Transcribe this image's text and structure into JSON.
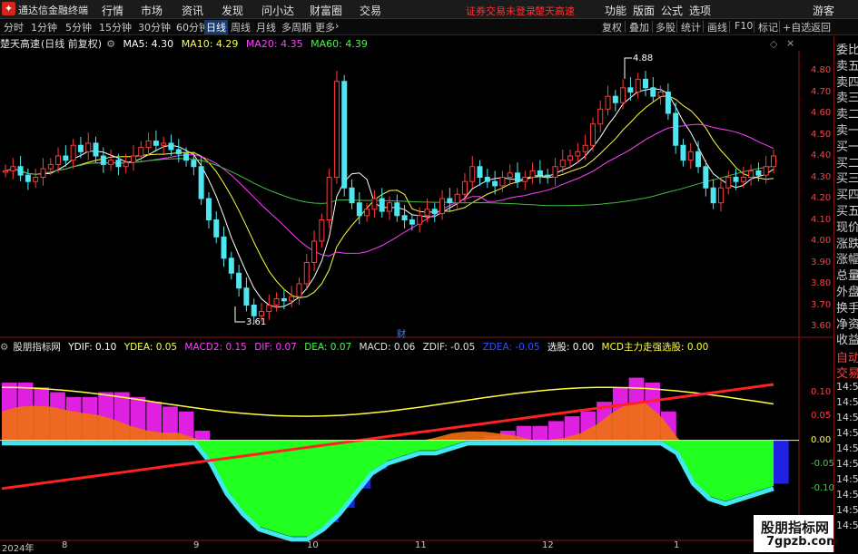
{
  "app": {
    "title": "通达信金融终端",
    "menu": [
      "行情",
      "市场",
      "资讯",
      "发现",
      "问小达",
      "财富圈",
      "交易"
    ],
    "notice": [
      "证券交易未登录",
      "楚天高速"
    ],
    "right_menu": [
      "功能",
      "版面",
      "公式",
      "选项"
    ],
    "guest": "游客"
  },
  "toolbar": {
    "periods": [
      "分时",
      "1分钟",
      "5分钟",
      "15分钟",
      "30分钟",
      "60分钟",
      "日线",
      "周线",
      "月线",
      "多周期",
      "更多"
    ],
    "active_period": "日线",
    "actions": [
      "复权",
      "叠加",
      "多股",
      "统计",
      "画线",
      "F10",
      "标记",
      "+自选",
      "返回"
    ]
  },
  "quote": {
    "name": "楚天高速",
    "mode": "(日线 前复权)",
    "ma": [
      {
        "label": "MA5: 4.30",
        "color": "#ffffff"
      },
      {
        "label": "MA10: 4.29",
        "color": "#ffff40"
      },
      {
        "label": "MA20: 4.35",
        "color": "#ff40ff"
      },
      {
        "label": "MA60: 4.39",
        "color": "#40ff40"
      }
    ],
    "high_label": "4.88",
    "low_label": "3.61",
    "event_marker": "财"
  },
  "price_axis": [
    "4.80",
    "4.70",
    "4.60",
    "4.50",
    "4.40",
    "4.30",
    "4.20",
    "4.10",
    "4.00",
    "3.90",
    "3.80",
    "3.70",
    "3.60"
  ],
  "indicator": {
    "name": "股朋指标网",
    "values": [
      {
        "label": "YDIF: 0.10",
        "color": "#ffffff"
      },
      {
        "label": "YDEA: 0.05",
        "color": "#ffff40"
      },
      {
        "label": "MACD2: 0.15",
        "color": "#ff40ff"
      },
      {
        "label": "DIF: 0.07",
        "color": "#ff40ff"
      },
      {
        "label": "DEA: 0.07",
        "color": "#40ff40"
      },
      {
        "label": "MACD: 0.06",
        "color": "#e0e0e0"
      },
      {
        "label": "ZDIF: -0.05",
        "color": "#e0e0e0"
      },
      {
        "label": "ZDEA: -0.05",
        "color": "#3050ff"
      },
      {
        "label": "选股: 0.00",
        "color": "#ffffff"
      },
      {
        "label": "MCD主力走强选股: 0.00",
        "color": "#ffff40"
      }
    ],
    "axis": [
      "0.10",
      "0.05",
      "0.00",
      "-0.05",
      "-0.10"
    ]
  },
  "x_axis": [
    "2024年",
    "8",
    "9",
    "10",
    "11",
    "12",
    "1"
  ],
  "right_panel": {
    "order_book": [
      "委比",
      "卖五",
      "卖四",
      "卖三",
      "卖二",
      "卖一",
      "买一",
      "买二",
      "买三",
      "买四",
      "买五",
      "现价",
      "涨跌",
      "涨幅",
      "总量",
      "外盘",
      "换手",
      "净资",
      "收益"
    ],
    "trade_tabs": [
      "自动",
      "交易"
    ],
    "ticks": [
      "14:56",
      "14:56",
      "14:56",
      "14:56",
      "14:56",
      "14:56",
      "14:56",
      "14:56",
      "14:56",
      "14:56"
    ]
  },
  "watermark": {
    "title": "股朋指标网",
    "url": "7gpzb.com"
  },
  "chart_data": [
    {
      "type": "candlestick",
      "title": "楚天高速",
      "ylim": [
        3.55,
        4.92
      ],
      "closes": [
        4.33,
        4.35,
        4.31,
        4.28,
        4.3,
        4.34,
        4.36,
        4.4,
        4.38,
        4.45,
        4.42,
        4.46,
        4.4,
        4.36,
        4.38,
        4.35,
        4.37,
        4.4,
        4.44,
        4.47,
        4.45,
        4.46,
        4.43,
        4.41,
        4.38,
        4.35,
        4.2,
        4.1,
        4.02,
        3.92,
        3.85,
        3.78,
        3.7,
        3.65,
        3.67,
        3.7,
        3.73,
        3.72,
        3.74,
        3.8,
        3.9,
        4.0,
        4.1,
        4.3,
        4.75,
        4.25,
        4.18,
        4.12,
        4.15,
        4.2,
        4.14,
        4.18,
        4.12,
        4.1,
        4.08,
        4.12,
        4.15,
        4.13,
        4.2,
        4.18,
        4.22,
        4.28,
        4.35,
        4.3,
        4.28,
        4.26,
        4.3,
        4.32,
        4.28,
        4.3,
        4.33,
        4.31,
        4.3,
        4.35,
        4.38,
        4.4,
        4.42,
        4.45,
        4.55,
        4.62,
        4.68,
        4.65,
        4.72,
        4.7,
        4.76,
        4.72,
        4.68,
        4.7,
        4.6,
        4.45,
        4.38,
        4.42,
        4.35,
        4.25,
        4.18,
        4.25,
        4.3,
        4.28,
        4.3,
        4.33,
        4.31,
        4.35,
        4.4
      ]
    },
    {
      "type": "area",
      "title": "股朋指标网",
      "ylim": [
        -0.2,
        0.18
      ],
      "series": [
        {
          "name": "MACD2",
          "values": [
            0.12,
            0.12,
            0.11,
            0.1,
            0.09,
            0.09,
            0.1,
            0.1,
            0.09,
            0.08,
            0.07,
            0.06,
            0.02,
            -0.04,
            -0.1,
            -0.14,
            -0.17,
            -0.18,
            -0.19,
            -0.19,
            -0.17,
            -0.14,
            -0.1,
            -0.06,
            -0.04,
            -0.03,
            -0.02,
            -0.02,
            -0.01,
            0.0,
            0.01,
            0.02,
            0.03,
            0.03,
            0.04,
            0.05,
            0.06,
            0.08,
            0.11,
            0.13,
            0.12,
            0.06,
            -0.02,
            -0.08,
            -0.11,
            -0.12,
            -0.11,
            -0.1,
            -0.09
          ]
        }
      ]
    }
  ]
}
